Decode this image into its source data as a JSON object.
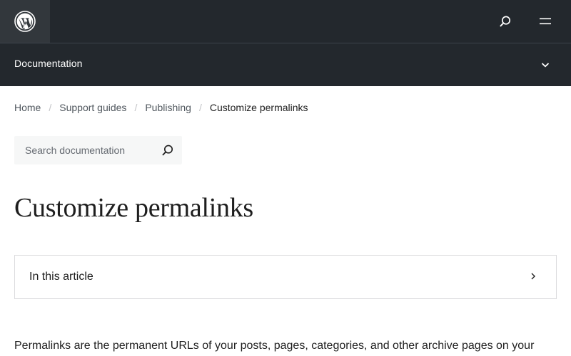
{
  "header": {
    "logo_icon": "wordpress-logo-icon",
    "search_icon": "search-icon",
    "menu_icon": "hamburger-menu-icon",
    "background": "#23282d"
  },
  "local_nav": {
    "title": "Documentation",
    "toggle_icon": "chevron-down-icon"
  },
  "breadcrumb": {
    "items": [
      "Home",
      "Support guides",
      "Publishing",
      "Customize permalinks"
    ],
    "separator": "/"
  },
  "search": {
    "placeholder": "Search documentation",
    "submit_icon": "search-icon"
  },
  "page": {
    "title": "Customize permalinks"
  },
  "toc": {
    "label": "In this article",
    "icon": "chevron-right-icon"
  },
  "content": {
    "intro": "Permalinks are the permanent URLs of your posts, pages, categories, and other archive pages on your"
  }
}
